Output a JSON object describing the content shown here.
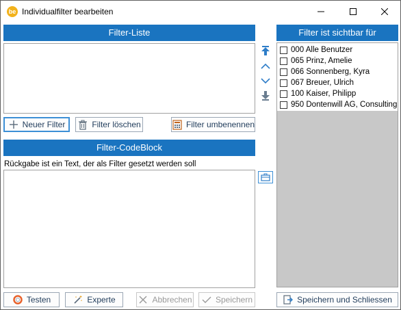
{
  "window": {
    "title": "Individualfilter bearbeiten",
    "app_icon_text": "be"
  },
  "filter_list": {
    "header": "Filter-Liste",
    "buttons": {
      "new": "Neuer Filter",
      "delete": "Filter löschen",
      "rename": "Filter umbenennen"
    }
  },
  "codeblock": {
    "header": "Filter-CodeBlock",
    "description": "Rückgabe ist ein Text, der als Filter gesetzt werden soll"
  },
  "visibility": {
    "header": "Filter ist sichtbar für",
    "users": [
      {
        "label": "000 Alle Benutzer",
        "checked": false
      },
      {
        "label": "065 Prinz, Amelie",
        "checked": false
      },
      {
        "label": "066 Sonnenberg, Kyra",
        "checked": false
      },
      {
        "label": "067 Breuer, Ulrich",
        "checked": false
      },
      {
        "label": "100 Kaiser, Philipp",
        "checked": false
      },
      {
        "label": "950 Dontenwill AG, Consulting",
        "checked": false
      }
    ]
  },
  "footer": {
    "test": "Testen",
    "expert": "Experte",
    "cancel": "Abbrechen",
    "save": "Speichern",
    "save_close": "Speichern und Schliessen"
  },
  "colors": {
    "header_bg": "#1a74c0",
    "accent": "#3c8fd6"
  }
}
